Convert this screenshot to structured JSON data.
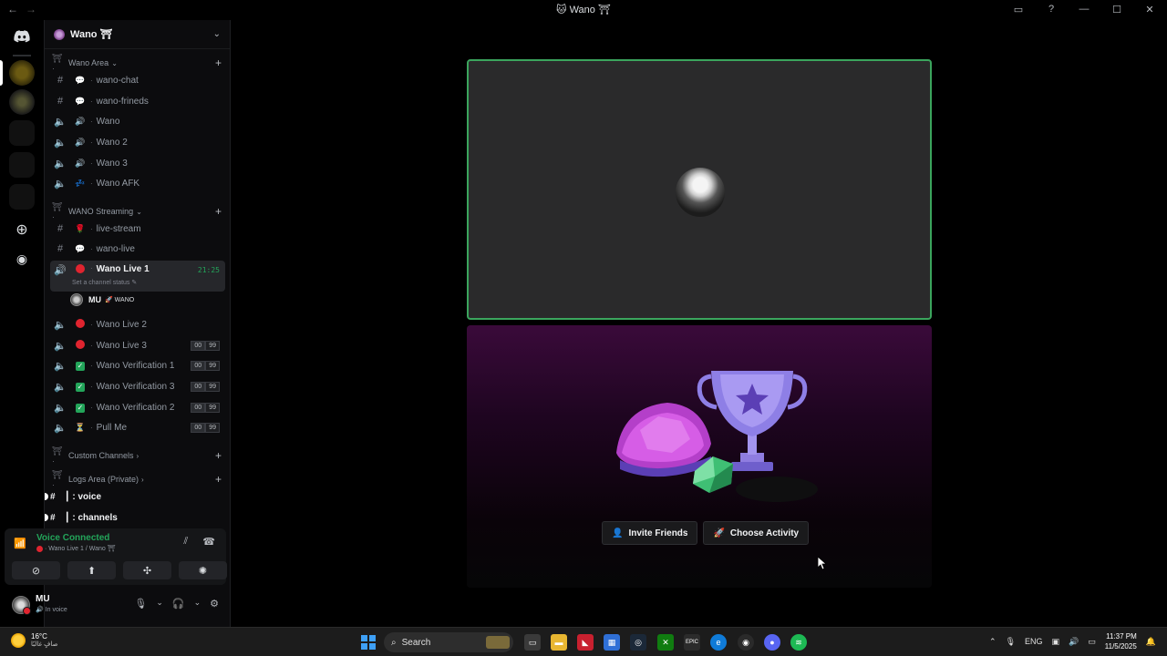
{
  "window": {
    "title": "Wano ⛩",
    "title_glyph": "🐱"
  },
  "colors": {
    "accent_green": "#23a55a",
    "speaking_border": "#3ba55d",
    "red_status": "#e0242f",
    "blurple": "#5865f2"
  },
  "server": {
    "name": "Wano ⛩"
  },
  "categories": {
    "wano_area": "Wano Area",
    "wano_streaming": "WANO Streaming",
    "custom_channels": "Custom Channels",
    "logs_area": "Logs Area (Private)"
  },
  "channels": {
    "wano_chat": "wano-chat",
    "wano_frineds": "wano-frineds",
    "wano": "Wano",
    "wano2": "Wano 2",
    "wano3": "Wano 3",
    "wano_afk": "Wano AFK",
    "live_stream": "live-stream",
    "wano_live": "wano-live",
    "wano_live1": "Wano Live 1",
    "wano_live1_timer": "21:25",
    "wano_live1_status": "Set a channel status",
    "wano_live2": "Wano Live 2",
    "wano_live3": "Wano Live 3",
    "verif1": "Wano Verification 1",
    "verif3": "Wano Verification 3",
    "verif2": "Wano Verification 2",
    "pull_me": "Pull Me",
    "voice": "┃ : voice",
    "channels_ch": "┃ : channels",
    "count_a": "00",
    "count_b": "99"
  },
  "voice_user": {
    "name": "MU",
    "tag": "WANO"
  },
  "voice_panel": {
    "title": "Voice Connected",
    "subtitle": "Wano Live 1 / Wano ⛩"
  },
  "user_panel": {
    "name": "MU",
    "status": "In voice"
  },
  "activity": {
    "invite_label": "Invite Friends",
    "choose_label": "Choose Activity"
  },
  "taskbar": {
    "temperature": "16°C",
    "weather": "صافٍ غالبًا",
    "search_placeholder": "Search",
    "lang": "ENG",
    "time": "11:37 PM",
    "date": "11/5/2025"
  }
}
